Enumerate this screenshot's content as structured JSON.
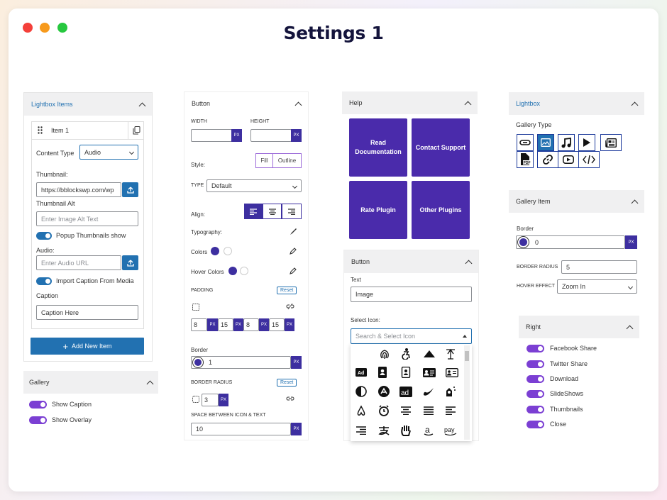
{
  "title": "Settings 1",
  "colors": {
    "accent_blue": "#2271b1",
    "accent_purple": "#4a2bab",
    "toggle_purple": "#7b3fd3"
  },
  "lightbox_items": {
    "header": "Lightbox Items",
    "item_label": "Item 1",
    "content_type_label": "Content Type",
    "content_type_value": "Audio",
    "thumbnail_label": "Thumbnail:",
    "thumbnail_value": "https://bblockswp.com/wp",
    "thumbnail_alt_label": "Thumbnail Alt",
    "thumbnail_alt_placeholder": "Enter Image Alt Text",
    "popup_thumbnails_label": "Popup Thumbnails show",
    "audio_label": "Audio:",
    "audio_placeholder": "Enter Audio URL",
    "import_caption_label": "Import Caption From Media",
    "caption_label": "Caption",
    "caption_value": "Caption Here",
    "add_button": "Add New Item"
  },
  "gallery": {
    "header": "Gallery",
    "show_caption": "Show Caption",
    "show_overlay": "Show Overlay"
  },
  "button_panel": {
    "header": "Button",
    "width_label": "WIDTH",
    "height_label": "HEIGHT",
    "unit": "PX",
    "style_label": "Style:",
    "style_fill": "Fill",
    "style_outline": "Outline",
    "type_label": "TYPE",
    "type_value": "Default",
    "align_label": "Align:",
    "typography_label": "Typography:",
    "colors_label": "Colors",
    "hover_colors_label": "Hover Colors",
    "padding_label": "PADDING",
    "reset": "Reset",
    "padding_values": [
      "8",
      "15",
      "8",
      "15"
    ],
    "border_label": "Border",
    "border_value": "1",
    "border_radius_label": "BORDER RADIUS",
    "border_radius_value": "3",
    "space_label": "SPACE BETWEEN ICON & TEXT",
    "space_value": "10"
  },
  "help": {
    "header": "Help",
    "tiles": [
      "Read Documentation",
      "Contact Support",
      "Rate Plugin",
      "Other Plugins"
    ]
  },
  "button_text_panel": {
    "header": "Button",
    "text_label": "Text",
    "text_value": "Image",
    "select_icon_label": "Select Icon:",
    "search_placeholder": "Search & Select Icon",
    "icons": [
      "fingerprint-icon",
      "accessible-icon",
      "accusoft-icon",
      "acquisitions-incorporated-icon",
      "ad-icon",
      "address-book-icon",
      "address-book-outline-icon",
      "address-card-icon",
      "address-card-outline-icon",
      "adjust-icon",
      "adn-icon",
      "adversal-icon",
      "affiliatetheme-icon",
      "air-freshener-icon",
      "airbnb-icon",
      "alarm-clock-icon",
      "align-center-icon",
      "align-justify-icon",
      "align-left-icon",
      "align-right-icon",
      "alipay-icon",
      "allergies-icon",
      "amazon-icon",
      "amazon-pay-icon"
    ]
  },
  "lightbox": {
    "header": "Lightbox",
    "gallery_type_label": "Gallery Type",
    "gallery_types": [
      "link-icon",
      "image-icon",
      "music-icon",
      "play-icon",
      "newspaper-icon",
      "pdf-icon",
      "chain-icon",
      "youtube-icon",
      "code-icon"
    ]
  },
  "gallery_item": {
    "header": "Gallery Item",
    "border_label": "Border",
    "border_value": "0",
    "unit": "PX",
    "border_radius_label": "BORDER RADIUS",
    "border_radius_value": "5",
    "hover_effect_label": "HOVER EFFECT",
    "hover_effect_value": "Zoom In"
  },
  "right": {
    "header": "Right",
    "items": [
      "Facebook Share",
      "Twitter Share",
      "Download",
      "SlideShows",
      "Thumbnails",
      "Close"
    ]
  }
}
